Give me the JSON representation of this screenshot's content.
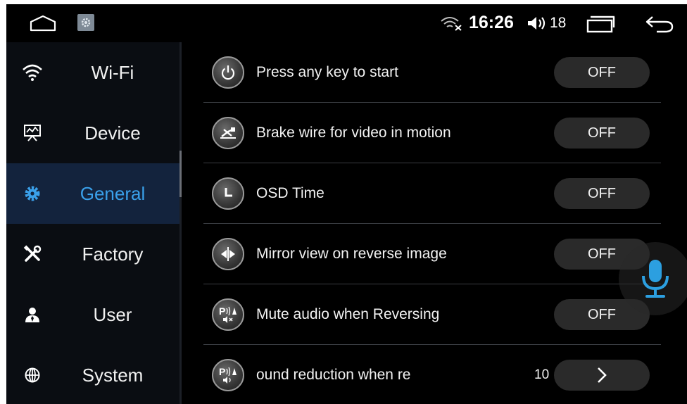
{
  "status_bar": {
    "time": "16:26",
    "volume": "18",
    "icons": [
      "home-icon",
      "settings-app-icon",
      "wifi-off-icon",
      "volume-icon",
      "recent-apps-icon",
      "back-icon"
    ]
  },
  "sidebar": {
    "items": [
      {
        "label": "Wi-Fi",
        "icon": "wifi-icon"
      },
      {
        "label": "Device",
        "icon": "monitor-chart-icon"
      },
      {
        "label": "General",
        "icon": "gear-icon",
        "active": true
      },
      {
        "label": "Factory",
        "icon": "tools-icon"
      },
      {
        "label": "User",
        "icon": "user-icon"
      },
      {
        "label": "System",
        "icon": "globe-icon"
      }
    ]
  },
  "settings": {
    "rows": [
      {
        "label": "Press any key to start",
        "icon": "power-icon",
        "value": "OFF"
      },
      {
        "label": "Brake wire for video in motion",
        "icon": "brake-icon",
        "value": "OFF"
      },
      {
        "label": "OSD Time",
        "icon": "clock-icon",
        "value": "OFF"
      },
      {
        "label": "Mirror view on reverse image",
        "icon": "mirror-icon",
        "value": "OFF"
      },
      {
        "label": "Mute audio when Reversing",
        "icon": "parking-mute-icon",
        "value": "OFF"
      },
      {
        "label": "ound reduction when re",
        "icon": "parking-volume-icon",
        "value": "10"
      }
    ]
  },
  "colors": {
    "accent": "#3aa0ea",
    "active_bg": "#13233d",
    "toggle_bg": "#2a2a2a",
    "mic": "#2c9fe0"
  }
}
